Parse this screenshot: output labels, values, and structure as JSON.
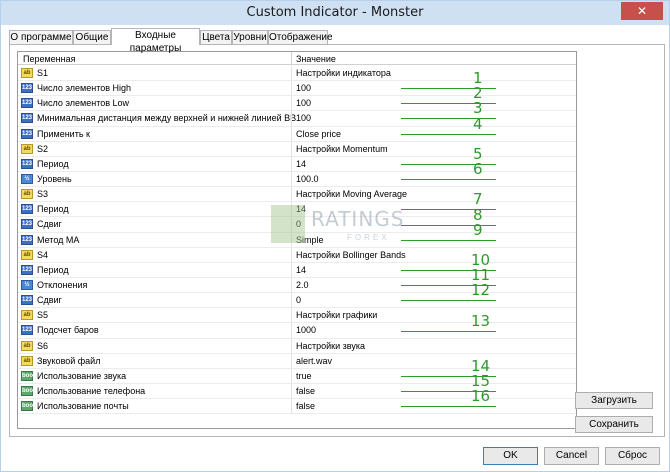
{
  "window": {
    "title": "Custom Indicator - Monster",
    "close_glyph": "✕"
  },
  "tabs": [
    {
      "label": "О программе"
    },
    {
      "label": "Общие"
    },
    {
      "label": "Входные параметры"
    },
    {
      "label": "Цвета"
    },
    {
      "label": "Уровни"
    },
    {
      "label": "Отображение"
    }
  ],
  "grid": {
    "col_variable": "Переменная",
    "col_value": "Значение",
    "rows": [
      {
        "icon": "ab",
        "name": "S1",
        "value": "Настройки индикатора"
      },
      {
        "icon": "123",
        "name": "Число элементов High",
        "value": "100"
      },
      {
        "icon": "123",
        "name": "Число элементов Low",
        "value": "100"
      },
      {
        "icon": "123",
        "name": "Минимальная дистанция между верхней и нижней линией BB",
        "value": "100"
      },
      {
        "icon": "123",
        "name": "Применить к",
        "value": "Close price"
      },
      {
        "icon": "ab",
        "name": "S2",
        "value": "Настройки Momentum"
      },
      {
        "icon": "123",
        "name": "Период",
        "value": "14"
      },
      {
        "icon": "½",
        "name": "Уровень",
        "value": "100.0"
      },
      {
        "icon": "ab",
        "name": "S3",
        "value": "Настройки Moving Average"
      },
      {
        "icon": "123",
        "name": "Период",
        "value": "14"
      },
      {
        "icon": "123",
        "name": "Сдвиг",
        "value": "0"
      },
      {
        "icon": "123",
        "name": "Метод MA",
        "value": "Simple"
      },
      {
        "icon": "ab",
        "name": "S4",
        "value": "Настройки Bollinger Bands"
      },
      {
        "icon": "123",
        "name": "Период",
        "value": "14"
      },
      {
        "icon": "½",
        "name": "Отклонения",
        "value": "2.0"
      },
      {
        "icon": "123",
        "name": "Сдвиг",
        "value": "0"
      },
      {
        "icon": "ab",
        "name": "S5",
        "value": "Настройки графики"
      },
      {
        "icon": "123",
        "name": "Подсчет баров",
        "value": "1000"
      },
      {
        "icon": "ab",
        "name": "S6",
        "value": "Настройки звука"
      },
      {
        "icon": "ab",
        "name": "Звуковой файл",
        "value": "alert.wav"
      },
      {
        "icon": "bool",
        "name": "Использование звука",
        "value": "true"
      },
      {
        "icon": "bool",
        "name": "Использование телефона",
        "value": "false"
      },
      {
        "icon": "bool",
        "name": "Использование почты",
        "value": "false"
      }
    ]
  },
  "annotations": [
    "1",
    "2",
    "3",
    "4",
    "5",
    "6",
    "7",
    "8",
    "9",
    "10",
    "11",
    "12",
    "13",
    "14",
    "15",
    "16"
  ],
  "watermark": {
    "text": "RATINGS",
    "sub": "FOREX"
  },
  "side_buttons": {
    "load": "Загрузить",
    "save": "Сохранить"
  },
  "footer_buttons": {
    "ok": "OK",
    "cancel": "Cancel",
    "reset": "Сброс"
  }
}
